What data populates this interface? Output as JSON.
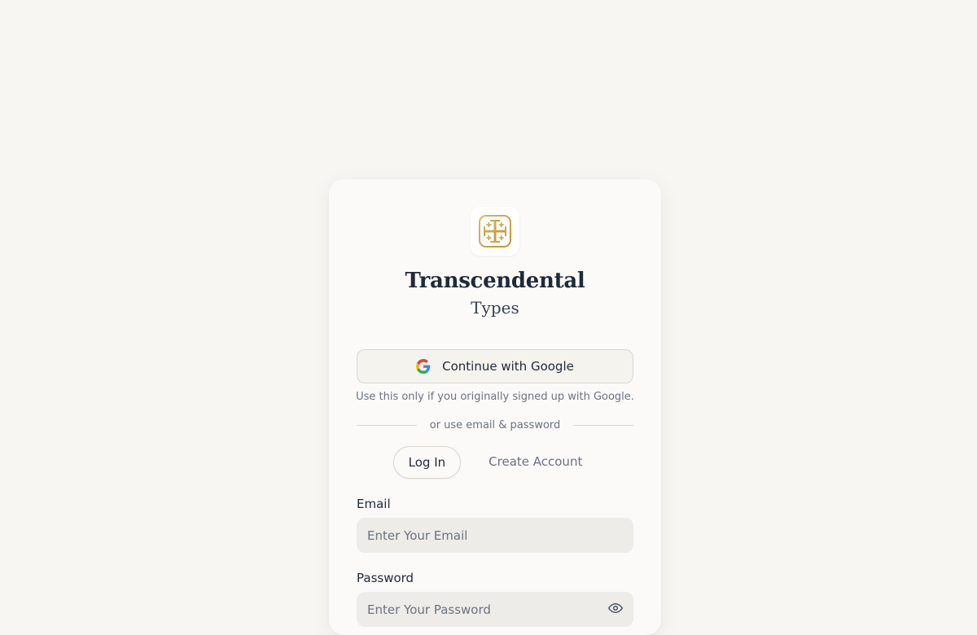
{
  "brand": {
    "title": "Transcendental",
    "subtitle": "Types",
    "logo_icon": "jerusalem-cross-icon",
    "logo_color": "#c9a64a"
  },
  "google": {
    "button_label": "Continue with Google",
    "icon": "google-icon",
    "note": "Use this only if you originally signed up with Google."
  },
  "divider": {
    "text": "or use email & password"
  },
  "tabs": [
    {
      "label": "Log In",
      "active": true
    },
    {
      "label": "Create Account",
      "active": false
    }
  ],
  "form": {
    "email": {
      "label": "Email",
      "placeholder": "Enter Your Email",
      "value": ""
    },
    "password": {
      "label": "Password",
      "placeholder": "Enter Your Password",
      "value": "",
      "toggle_icon": "eye-icon"
    }
  },
  "colors": {
    "background": "#f7f6f2",
    "card": "#fbfaf8",
    "input": "#eeece8",
    "text_primary": "#1f2937",
    "text_muted": "#6b7280",
    "accent_gold": "#c9a64a"
  }
}
